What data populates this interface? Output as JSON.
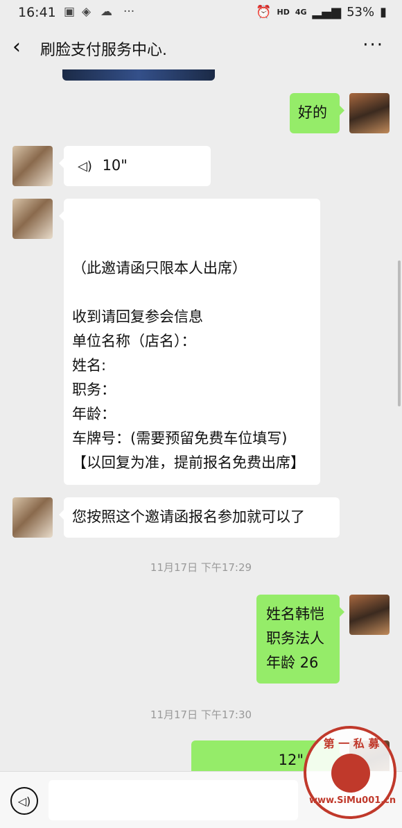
{
  "status_bar": {
    "time": "16:41",
    "hd": "HD",
    "network": "4G",
    "battery": "53%"
  },
  "header": {
    "back_icon": "chevron-left-icon",
    "title": "刷脸支付服务中心.",
    "more_icon": "more-dots-icon"
  },
  "messages": {
    "reply_ok": "好的",
    "voice1_duration": "10\"",
    "invite_lines": [
      "（此邀请函只限本人出席）",
      "收到请回复参会信息",
      "单位名称（店名）：",
      "姓名:",
      "职务：",
      "年龄：",
      "车牌号：(需要预留免费车位填写)",
      "【以回复为准，提前报名免费出席】"
    ],
    "instruction": "您按照这个邀请函报名参加就可以了",
    "timestamp1": "11月17日 下午17:29",
    "reply_info": [
      "姓名韩恺",
      "职务法人",
      "年龄 26"
    ],
    "timestamp2": "11月17日 下午17:30",
    "voice2_duration": "12\""
  },
  "watermark": {
    "text": "第 一 私 募",
    "url": "www.SiMu001.cn"
  }
}
